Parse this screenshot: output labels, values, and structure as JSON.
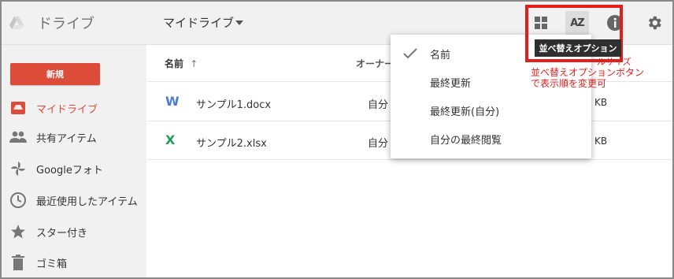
{
  "header": {
    "app_title": "ドライブ",
    "folder_title": "マイドライブ"
  },
  "toolbar": {
    "tooltip": "並べ替えオプション",
    "sort_icon_text": "AZ"
  },
  "sidebar": {
    "new_label": "新規",
    "items": [
      {
        "label": "マイドライブ",
        "icon": "drive-icon"
      },
      {
        "label": "共有アイテム",
        "icon": "people-icon"
      },
      {
        "label": "Googleフォト",
        "icon": "photos-icon"
      },
      {
        "label": "最近使用したアイテム",
        "icon": "clock-icon"
      },
      {
        "label": "スター付き",
        "icon": "star-icon"
      },
      {
        "label": "ゴミ箱",
        "icon": "trash-icon"
      }
    ]
  },
  "list": {
    "col_name": "名前",
    "col_owner": "オーナー",
    "col_size_partial": "ルサイズ",
    "files": [
      {
        "icon": "W",
        "name": "サンプル1.docx",
        "owner": "自分",
        "size": "KB"
      },
      {
        "icon": "X",
        "name": "サンプル2.xlsx",
        "owner": "自分",
        "size": "KB"
      }
    ]
  },
  "sort_menu": {
    "items": [
      "名前",
      "最終更新",
      "最終更新(自分)",
      "自分の最終閲覧"
    ]
  },
  "annotation": {
    "line1": "並べ替えオプションボタン",
    "line2": "で表示順を変更可"
  },
  "colors": {
    "accent_red": "#dd4b39",
    "highlight": "#e0201d",
    "word_blue": "#4a7bd6",
    "excel_green": "#1e9e5a"
  }
}
